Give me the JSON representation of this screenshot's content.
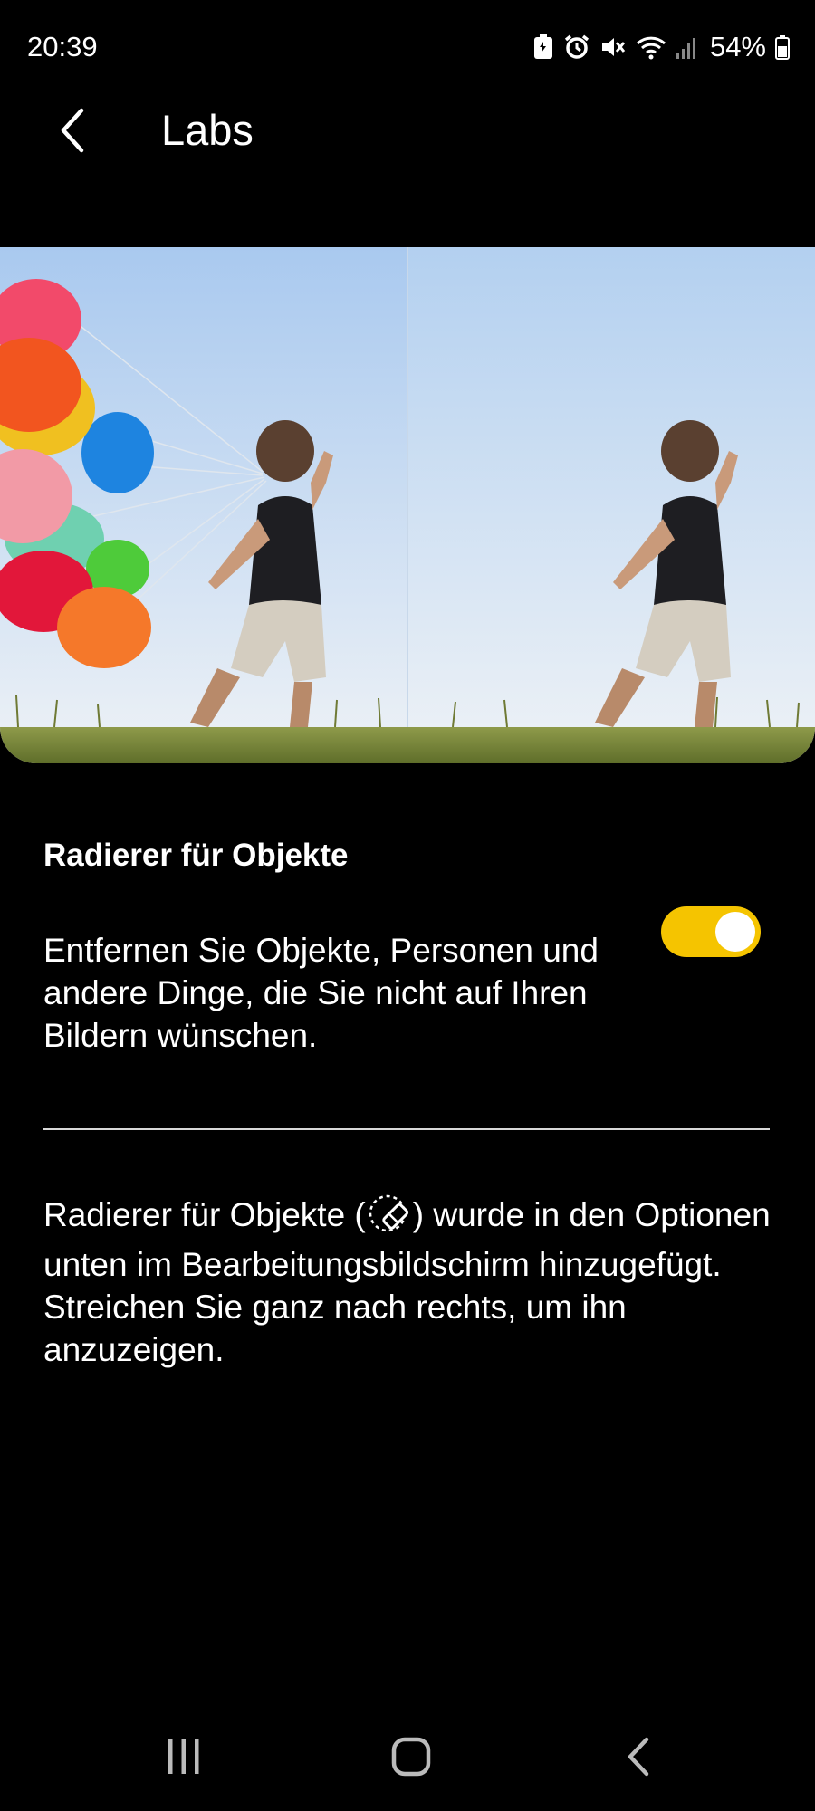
{
  "status_bar": {
    "time": "20:39",
    "battery": "54%",
    "icons": [
      "battery-saver-icon",
      "alarm-icon",
      "mute-icon",
      "wifi-icon",
      "signal-icon",
      "battery-icon"
    ]
  },
  "app_bar": {
    "title": "Labs",
    "back_icon": "chevron-left-icon"
  },
  "setting": {
    "title": "Radierer für Objekte",
    "description": "Entfernen Sie Objekte, Personen und andere Dinge, die Sie nicht auf Ihren Bildern wünschen.",
    "enabled": true
  },
  "info": {
    "before_icon": "Radierer für Objekte (",
    "icon": "object-eraser-icon",
    "after_icon": ") wurde in den Optionen unten im Bearbeitungsbildschirm hinzugefügt. Streichen Sie ganz nach rechts, um ihn anzuzeigen."
  },
  "nav_bar": {
    "items": [
      "recent-apps-icon",
      "home-icon",
      "back-icon"
    ]
  },
  "colors": {
    "background": "#000000",
    "toggle_on": "#f5c400",
    "sky_top": "#a9c9ef",
    "sky_bottom": "#e8eff6"
  }
}
